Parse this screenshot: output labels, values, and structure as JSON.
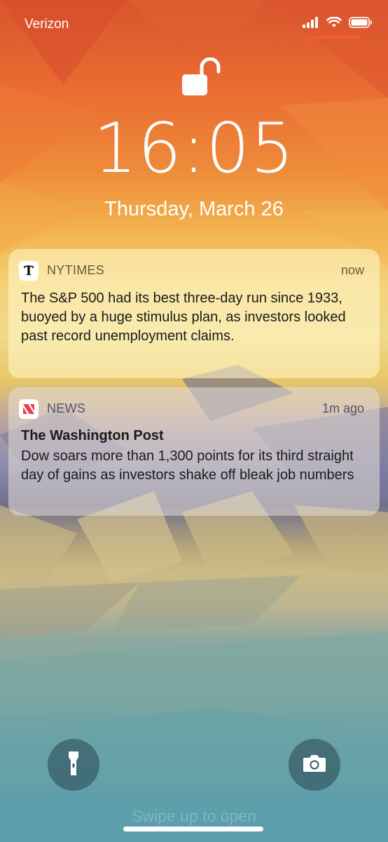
{
  "status_bar": {
    "carrier": "Verizon"
  },
  "lock_screen": {
    "time": "16:05",
    "date": "Thursday, March 26"
  },
  "notifications": [
    {
      "app": "NYTIMES",
      "time": "now",
      "title": "",
      "body": "The S&P 500 had its best three-day run since 1933, buoyed by a huge stimulus plan, as investors looked past record unemployment claims."
    },
    {
      "app": "NEWS",
      "time": "1m ago",
      "title": "The Washington Post",
      "body": "Dow soars more than 1,300 points for its third straight day of gains as investors shake off bleak job numbers"
    }
  ],
  "bottom": {
    "swipe_text": "Swipe up to open"
  },
  "colors": {
    "accent_underline": "#ff5a3c",
    "news_icon_red": "#f0394d"
  },
  "icons": {
    "lock": "unlocked-padlock-icon",
    "flashlight": "flashlight-icon",
    "camera": "camera-icon",
    "signal": "cellular-signal-icon",
    "wifi": "wifi-icon",
    "battery": "battery-icon"
  }
}
